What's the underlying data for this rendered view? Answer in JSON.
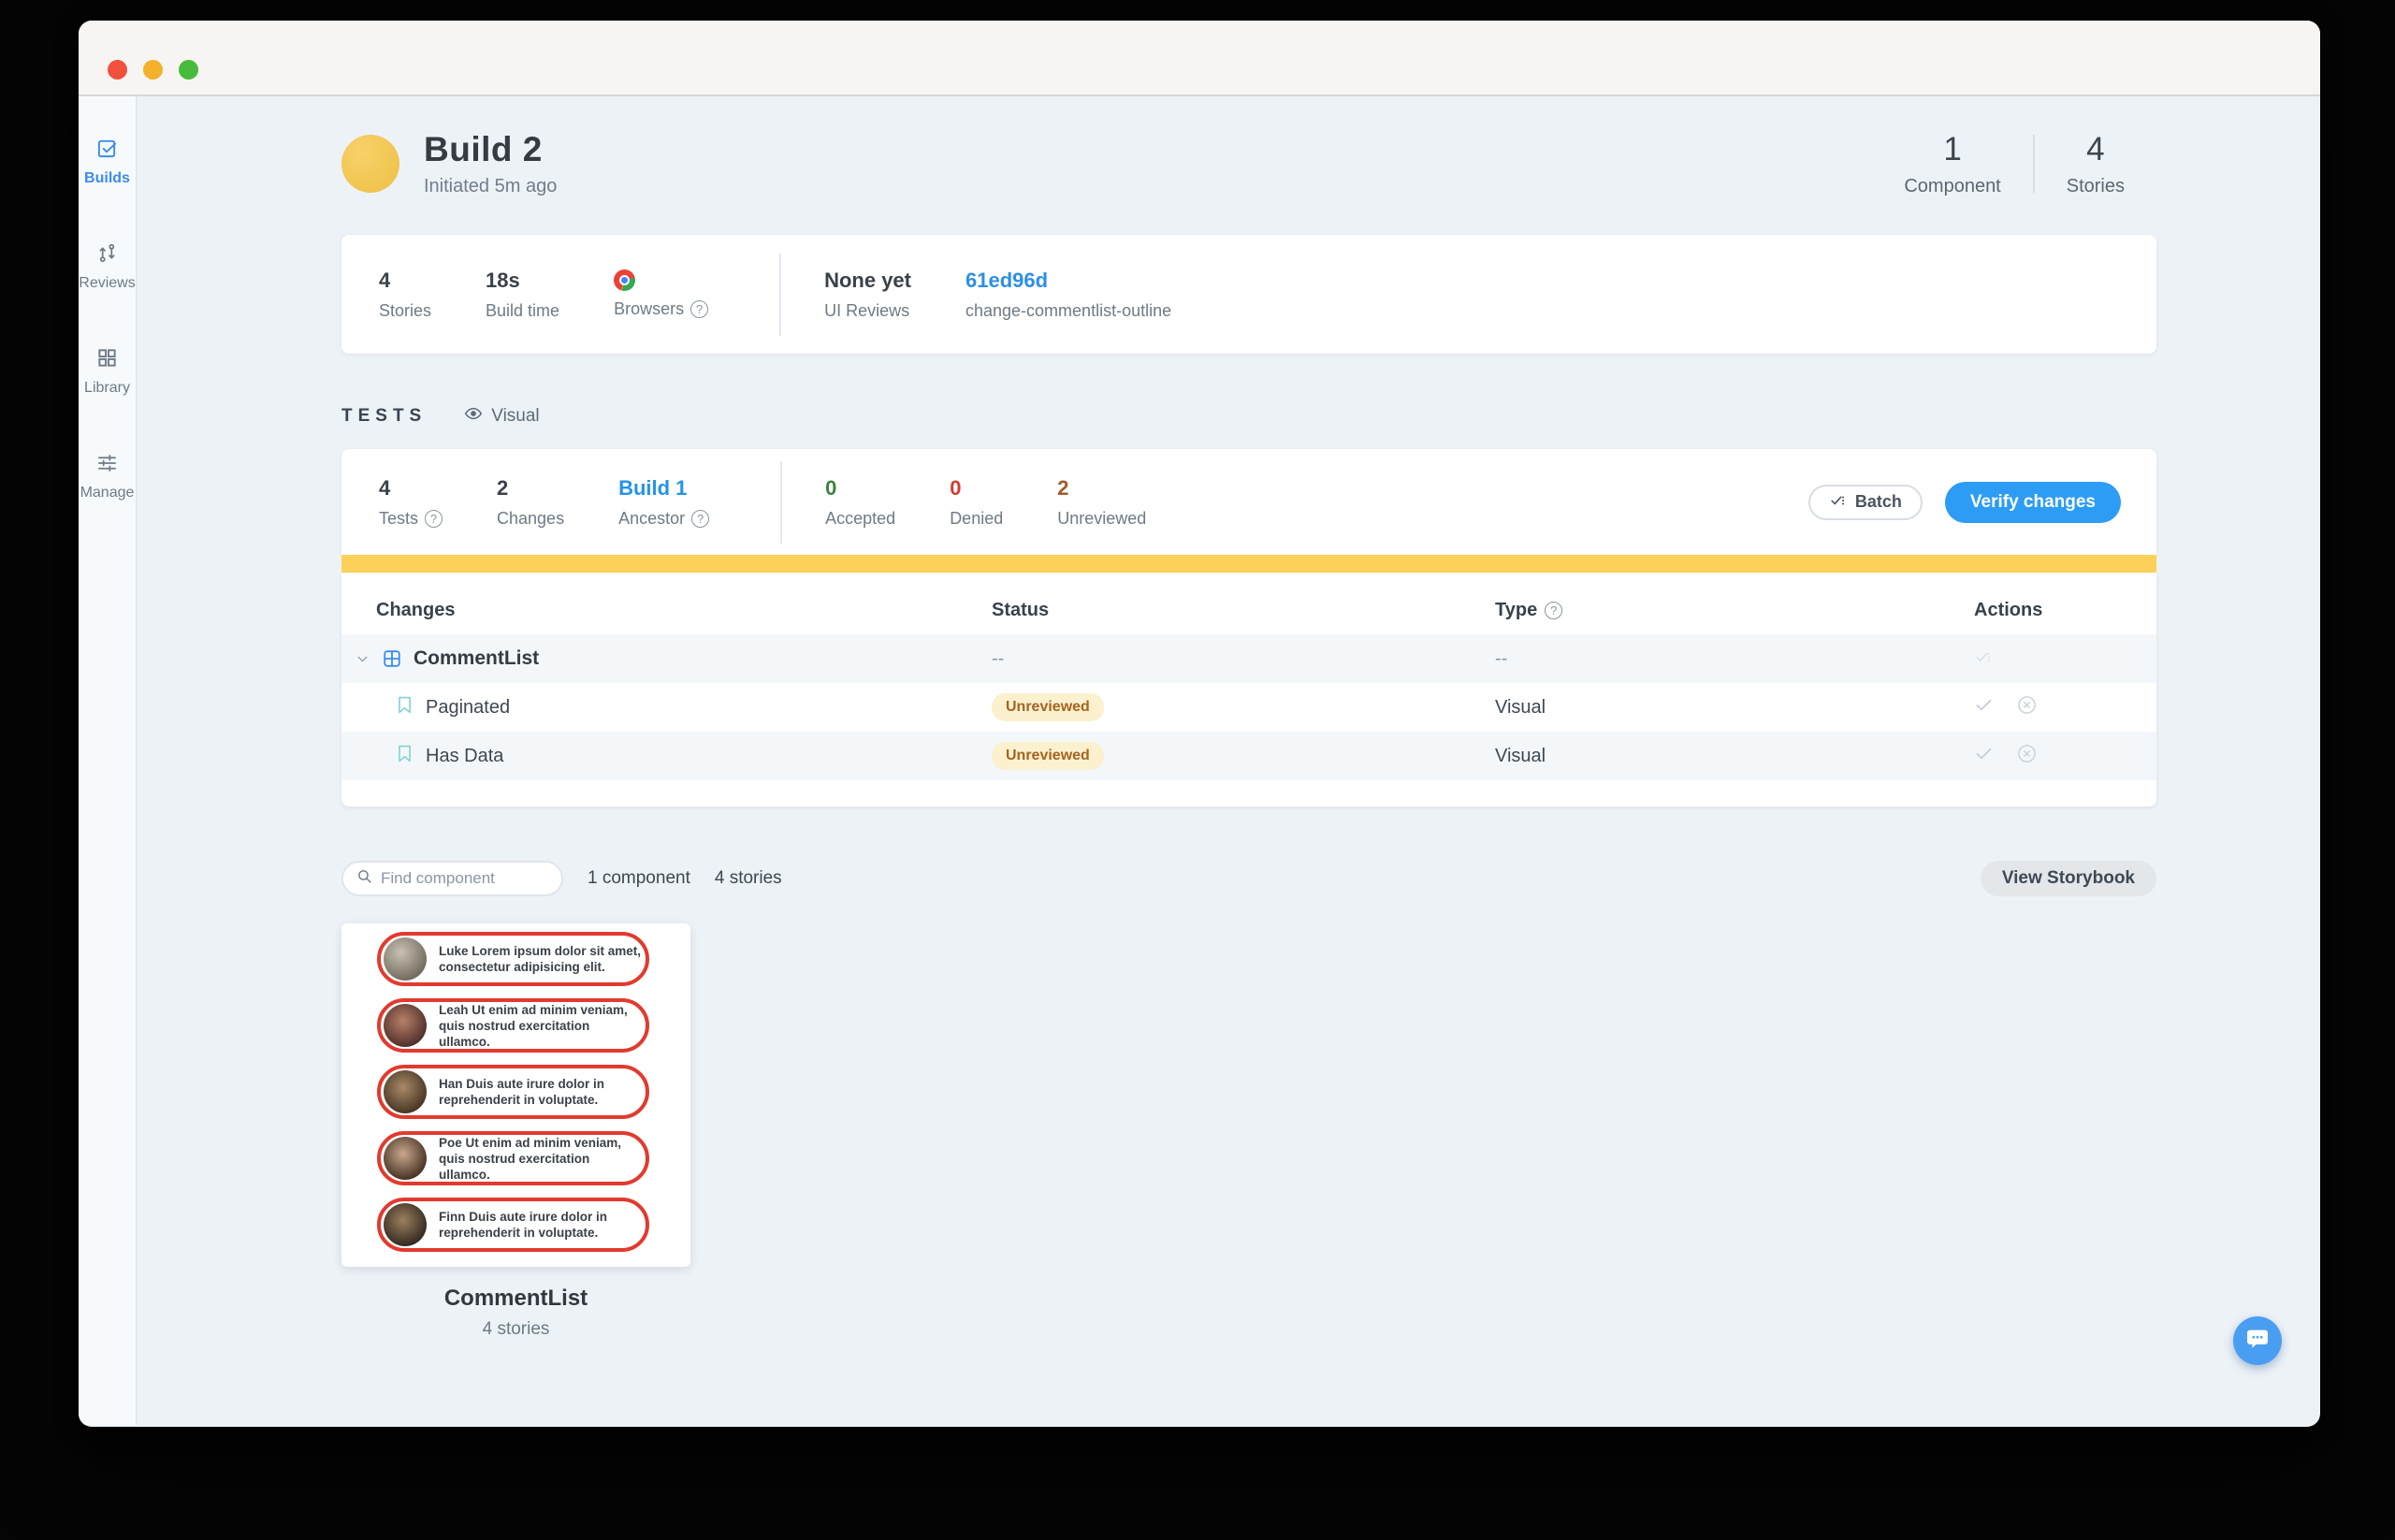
{
  "colors": {
    "accent_blue": "#2d9cf4",
    "link_blue": "#2c8fe8",
    "progress_yellow": "#fcd159",
    "badge_bg": "#fcf1cf",
    "badge_text": "#a5641f",
    "accepted_green": "#3d8240",
    "denied_red": "#d9392e",
    "unreviewed_orange": "#a8582a",
    "story_outline_red": "#e23a2e",
    "build_avatar_yellow": "#f3c74f"
  },
  "sidebar": {
    "items": [
      {
        "label": "Builds"
      },
      {
        "label": "Reviews"
      },
      {
        "label": "Library"
      },
      {
        "label": "Manage"
      }
    ]
  },
  "header": {
    "title": "Build 2",
    "subtitle": "Initiated 5m ago",
    "counts": [
      {
        "value": "1",
        "label": "Component"
      },
      {
        "value": "4",
        "label": "Stories"
      }
    ]
  },
  "build_stats": {
    "stories": {
      "value": "4",
      "label": "Stories"
    },
    "build_time": {
      "value": "18s",
      "label": "Build time"
    },
    "browsers": {
      "label": "Browsers"
    },
    "ui_reviews": {
      "value": "None yet",
      "label": "UI Reviews"
    },
    "commit": {
      "hash": "61ed96d",
      "branch": "change-commentlist-outline"
    }
  },
  "tests": {
    "section_label": "TESTS",
    "filter_label": "Visual",
    "stats": [
      {
        "value": "4",
        "label": "Tests"
      },
      {
        "value": "2",
        "label": "Changes"
      },
      {
        "value": "Build 1",
        "label": "Ancestor"
      }
    ],
    "review_stats": [
      {
        "value": "0",
        "label": "Accepted"
      },
      {
        "value": "0",
        "label": "Denied"
      },
      {
        "value": "2",
        "label": "Unreviewed"
      }
    ],
    "batch_button": "Batch",
    "verify_button": "Verify changes"
  },
  "table": {
    "headers": {
      "changes": "Changes",
      "status": "Status",
      "type": "Type",
      "actions": "Actions"
    },
    "rows": [
      {
        "name": "CommentList",
        "status": "--",
        "type": "--"
      },
      {
        "name": "Paginated",
        "status": "Unreviewed",
        "type": "Visual"
      },
      {
        "name": "Has Data",
        "status": "Unreviewed",
        "type": "Visual"
      }
    ]
  },
  "components_section": {
    "search_placeholder": "Find component",
    "component_count": "1 component",
    "story_count": "4 stories",
    "view_storybook_button": "View Storybook",
    "component": {
      "name": "CommentList",
      "stories_label": "4 stories",
      "comments": [
        {
          "author": "Luke",
          "text": "Luke Lorem ipsum dolor sit amet, consectetur adipisicing elit."
        },
        {
          "author": "Leah",
          "text": "Leah Ut enim ad minim veniam, quis nostrud exercitation ullamco."
        },
        {
          "author": "Han",
          "text": "Han Duis aute irure dolor in reprehenderit in voluptate."
        },
        {
          "author": "Poe",
          "text": "Poe Ut enim ad minim veniam, quis nostrud exercitation ullamco."
        },
        {
          "author": "Finn",
          "text": "Finn Duis aute irure dolor in reprehenderit in voluptate."
        }
      ]
    }
  }
}
